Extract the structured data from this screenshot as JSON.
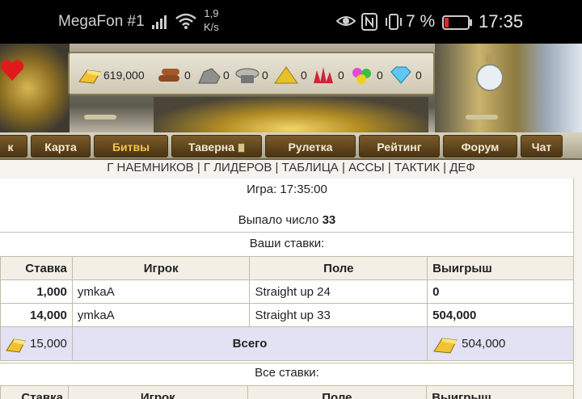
{
  "status": {
    "carrier": "MegaFon #1",
    "speed_value": "1,9",
    "speed_unit": "K/s",
    "battery": "7 %",
    "time": "17:35"
  },
  "resources": {
    "gold": "619,000",
    "wood": "0",
    "ore": "0",
    "mercury": "0",
    "sulfur": "0",
    "crystal": "0",
    "gems": "0",
    "diamond": "0"
  },
  "nav": [
    "к",
    "Карта",
    "Битвы",
    "Таверна",
    "Рулетка",
    "Рейтинг",
    "Форум",
    "Чат"
  ],
  "sublinks": "Г НАЕМНИКОВ | Г ЛИДЕРОВ | ТАБЛИЦА | АССЫ | ТАКТИК | ДЕФ",
  "game": {
    "label": "Игра: 17:35:00",
    "result_label": "Выпало число",
    "result_number": "33",
    "your_bets": "Ваши ставки:",
    "all_bets": "Все ставки:"
  },
  "table": {
    "headers": [
      "Ставка",
      "Игрок",
      "Поле",
      "Выигрыш"
    ],
    "rows": [
      {
        "bet": "1,000",
        "player": "ymkaA",
        "field": "Straight up 24",
        "win": "0"
      },
      {
        "bet": "14,000",
        "player": "ymkaA",
        "field": "Straight up 33",
        "win": "504,000"
      }
    ],
    "total_bet": "15,000",
    "total_label": "Всего",
    "total_win": "504,000"
  },
  "colors": {
    "accent": "#f5c24a",
    "total_row": "#e2e2f4",
    "nav_bg": "#4b3412"
  }
}
